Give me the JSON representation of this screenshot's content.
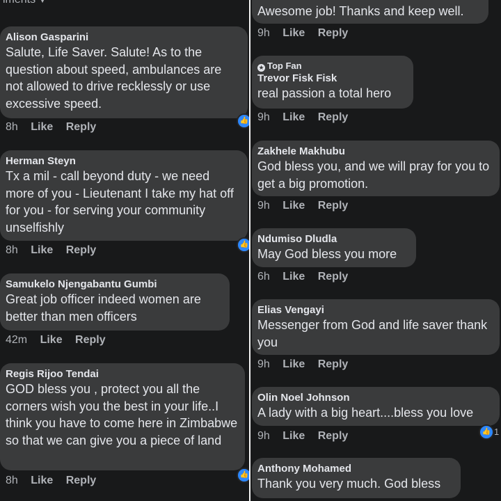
{
  "left_top_label": "iments",
  "left": [
    {
      "author": "Alison Gasparini",
      "text": "Salute, Life Saver. Salute! As to the question about speed, ambulances are not allowed to drive recklessly or use excessive speed.",
      "time": "8h",
      "like": "Like",
      "reply": "Reply",
      "reaction": "like-icon"
    },
    {
      "author": "Herman Steyn",
      "text": "Tx a mil - call beyond duty - we need more of you - Lieutenant I take my hat off for you - for serving your community unselfishly",
      "time": "8h",
      "like": "Like",
      "reply": "Reply",
      "reaction": "like-icon"
    },
    {
      "author": "Samukelo Njengabantu Gumbi",
      "text": "Great job officer indeed  women are better than men officers",
      "time": "42m",
      "like": "Like",
      "reply": "Reply"
    },
    {
      "author": "Regis Rijoo Tendai",
      "text": "GOD bless you , protect you all the corners wish you the best in your life..I think you have to come here in Zimbabwe so that we can give you a piece of land",
      "time": "8h",
      "like": "Like",
      "reply": "Reply",
      "reaction": "like-icon"
    }
  ],
  "right": [
    {
      "author": "",
      "text": "Awesome job! Thanks and keep well.",
      "time": "9h",
      "like": "Like",
      "reply": "Reply"
    },
    {
      "badge": "Top Fan",
      "author": "Trevor Fisk Fisk",
      "text": "real passion a total hero",
      "time": "9h",
      "like": "Like",
      "reply": "Reply"
    },
    {
      "author": "Zakhele Makhubu",
      "text": "God bless you, and we will pray for you to get a big promotion.",
      "time": "9h",
      "like": "Like",
      "reply": "Reply"
    },
    {
      "author": "Ndumiso Dludla",
      "text": "May God bless you more",
      "time": "6h",
      "like": "Like",
      "reply": "Reply"
    },
    {
      "author": "Elias Vengayi",
      "text": "Messenger from God and life saver thank you",
      "time": "9h",
      "like": "Like",
      "reply": "Reply"
    },
    {
      "author": "Olin Noel Johnson",
      "text": "A lady with a big heart....bless you love",
      "time": "9h",
      "like": "Like",
      "reply": "Reply",
      "reaction": "like-icon",
      "reaction_count": "1"
    },
    {
      "author": "Anthony Mohamed",
      "text": "Thank you very much. God bless"
    }
  ]
}
